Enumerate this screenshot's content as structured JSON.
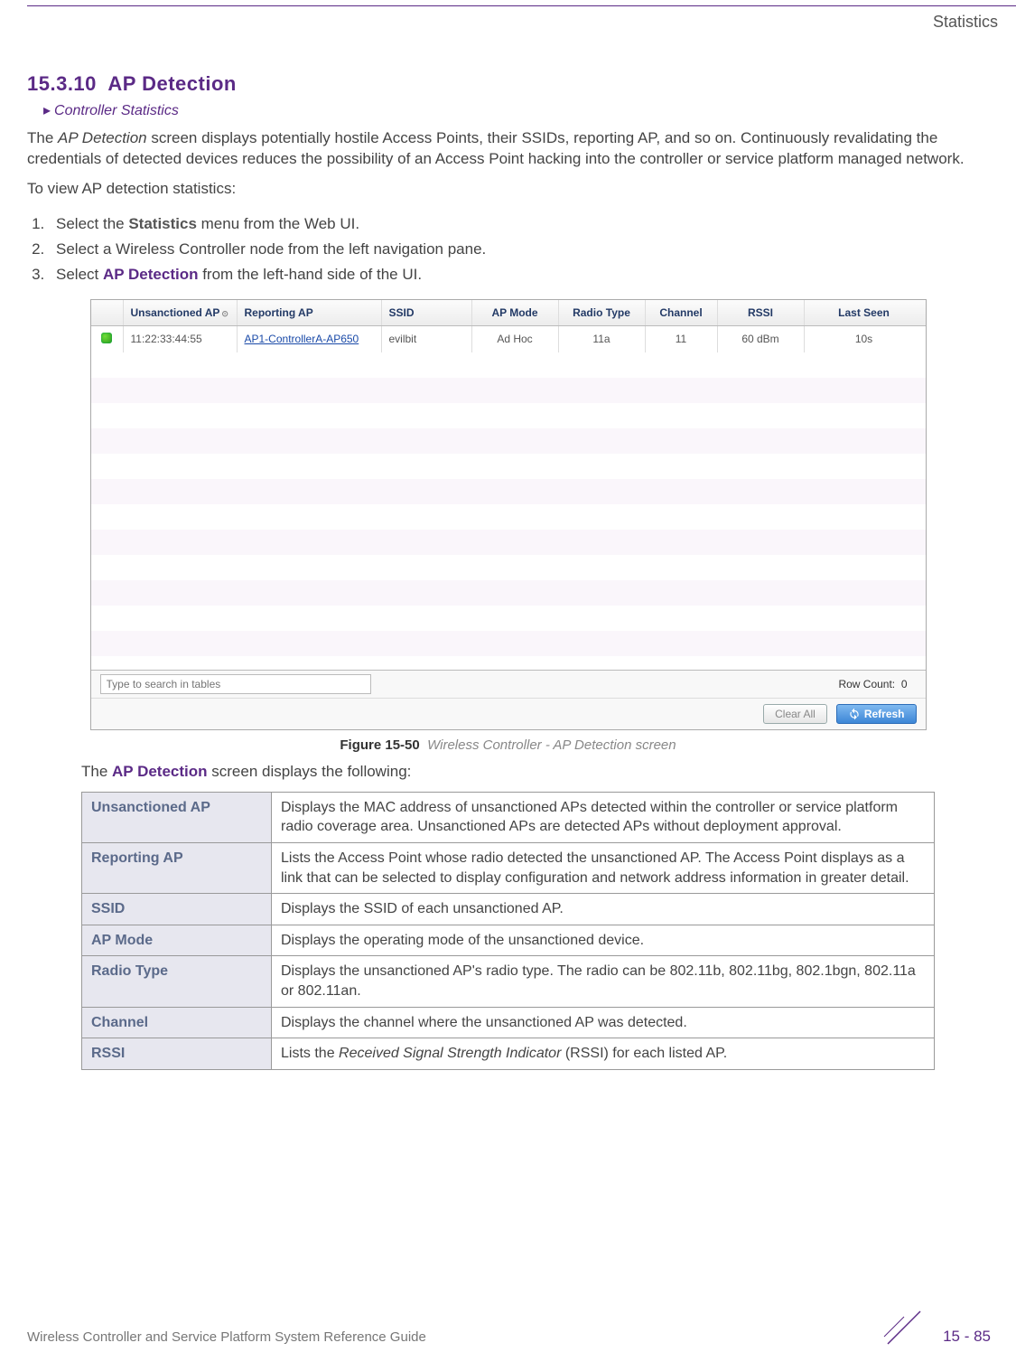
{
  "page": {
    "header_right": "Statistics",
    "section_number": "15.3.10",
    "section_title": "AP Detection",
    "breadcrumb": "Controller Statistics",
    "intro_pre": "The ",
    "intro_em": "AP Detection",
    "intro_post": " screen displays potentially hostile Access Points, their SSIDs, reporting AP, and so on. Continuously revalidating the credentials of detected devices reduces the possibility of an Access Point hacking into the controller or service platform managed network.",
    "lead": "To view AP detection statistics:",
    "steps": [
      {
        "pre": "Select the ",
        "bold": "Statistics",
        "post": " menu from the Web UI."
      },
      {
        "pre": "Select a Wireless Controller node from the left navigation pane.",
        "bold": "",
        "post": ""
      },
      {
        "pre": "Select ",
        "bold": "AP Detection",
        "post": " from the left-hand side of the UI."
      }
    ],
    "caption_label": "Figure 15-50",
    "caption_text": "Wireless Controller - AP Detection screen",
    "after_intro_pre": "The ",
    "after_intro_bold": "AP Detection",
    "after_intro_post": " screen displays the following:",
    "footer_text": "Wireless Controller and Service Platform System Reference Guide",
    "page_number": "15 - 85"
  },
  "screenshot": {
    "headers": {
      "unsanctioned": "Unsanctioned AP",
      "reporting": "Reporting AP",
      "ssid": "SSID",
      "ap_mode": "AP Mode",
      "radio_type": "Radio Type",
      "channel": "Channel",
      "rssi": "RSSI",
      "last_seen": "Last Seen"
    },
    "rows": [
      {
        "unsanctioned": "11:22:33:44:55",
        "reporting": "AP1-ControllerA-AP650",
        "ssid": "evilbit",
        "ap_mode": "Ad Hoc",
        "radio_type": "11a",
        "channel": "11",
        "rssi": "60 dBm",
        "last_seen": "10s"
      }
    ],
    "search_placeholder": "Type to search in tables",
    "row_count_label": "Row Count:",
    "row_count_value": "0",
    "btn_clear": "Clear All",
    "btn_refresh": "Refresh"
  },
  "definitions": [
    {
      "term": "Unsanctioned AP",
      "desc": "Displays the MAC address of unsanctioned APs detected within the controller or service platform radio coverage area. Unsanctioned APs are detected APs without deployment approval."
    },
    {
      "term": "Reporting AP",
      "desc": "Lists the Access Point whose radio detected the unsanctioned AP. The Access Point displays as a link that can be selected to display configuration and network address information in greater detail."
    },
    {
      "term": "SSID",
      "desc": "Displays the SSID of each unsanctioned AP."
    },
    {
      "term": "AP Mode",
      "desc": "Displays the operating mode of the unsanctioned device."
    },
    {
      "term": "Radio Type",
      "desc": "Displays the unsanctioned AP's radio type. The radio can be 802.11b, 802.11bg, 802.1bgn, 802.11a or 802.11an."
    },
    {
      "term": "Channel",
      "desc": "Displays the channel where the unsanctioned AP was detected."
    },
    {
      "term": "RSSI",
      "desc_pre": "Lists the ",
      "desc_em": "Received Signal Strength Indicator",
      "desc_post": " (RSSI) for each listed AP."
    }
  ]
}
